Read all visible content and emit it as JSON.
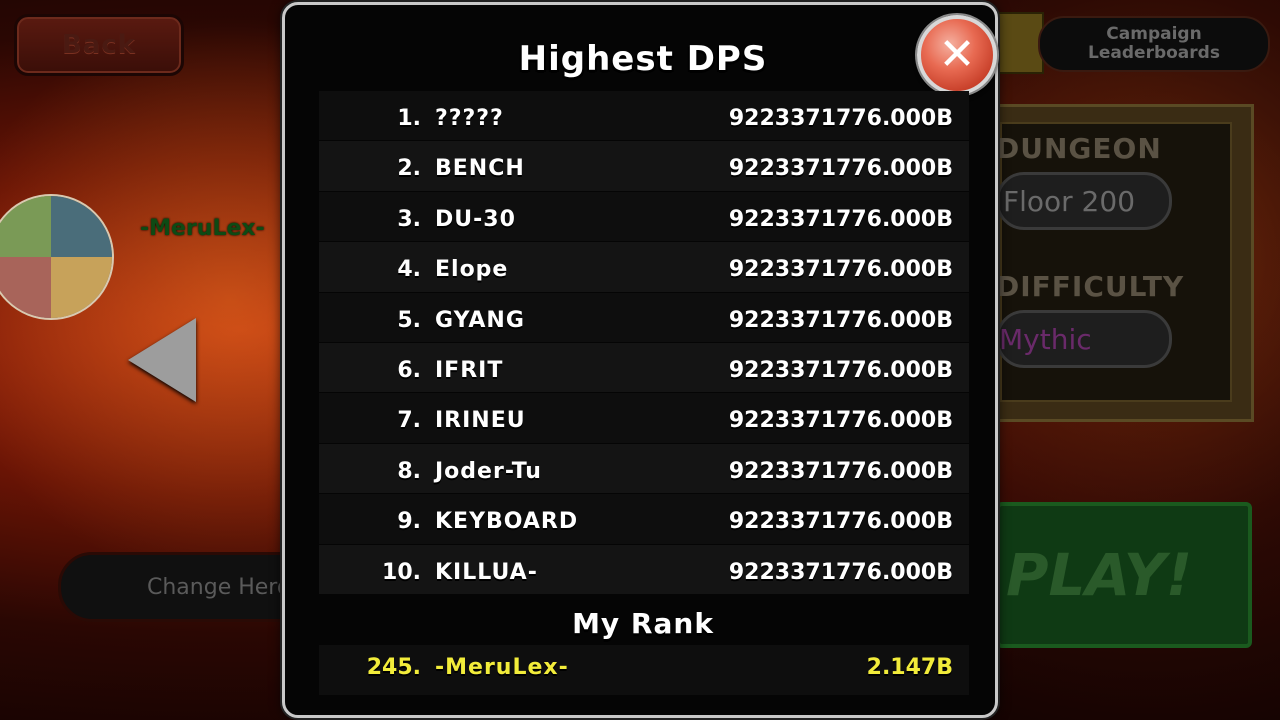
{
  "background": {
    "back_label": "Back",
    "player_name": "-MeruLex-",
    "change_hero_label": "Change Hero",
    "campaign_label_line1": "Campaign",
    "campaign_label_line2": "Leaderboards",
    "dungeon_label": "DUNGEON",
    "floor_value": "Floor 200",
    "difficulty_label": "DIFFICULTY",
    "difficulty_value": "Mythic",
    "play_label": "PLAY!"
  },
  "modal": {
    "title": "Highest DPS",
    "close_symbol": "✕",
    "close_icon": "close-icon",
    "rows": [
      {
        "rank": "1.",
        "name": "?????",
        "score": "9223371776.000B"
      },
      {
        "rank": "2.",
        "name": "BENCH",
        "score": "9223371776.000B"
      },
      {
        "rank": "3.",
        "name": "DU-30",
        "score": "9223371776.000B"
      },
      {
        "rank": "4.",
        "name": "Elope",
        "score": "9223371776.000B"
      },
      {
        "rank": "5.",
        "name": "GYANG",
        "score": "9223371776.000B"
      },
      {
        "rank": "6.",
        "name": "IFRIT",
        "score": "9223371776.000B"
      },
      {
        "rank": "7.",
        "name": "IRINEU",
        "score": "9223371776.000B"
      },
      {
        "rank": "8.",
        "name": "Joder-Tu",
        "score": "9223371776.000B"
      },
      {
        "rank": "9.",
        "name": "KEYBOARD",
        "score": "9223371776.000B"
      },
      {
        "rank": "10.",
        "name": "KILLUA-",
        "score": "9223371776.000B"
      }
    ],
    "my_rank_title": "My Rank",
    "my_rank": {
      "rank": "245.",
      "name": "-MeruLex-",
      "score": "2.147B"
    }
  },
  "colors": {
    "my_rank_text": "#f2ec3a",
    "close_button": "#e86a52",
    "modal_border": "#c9c9c9"
  }
}
